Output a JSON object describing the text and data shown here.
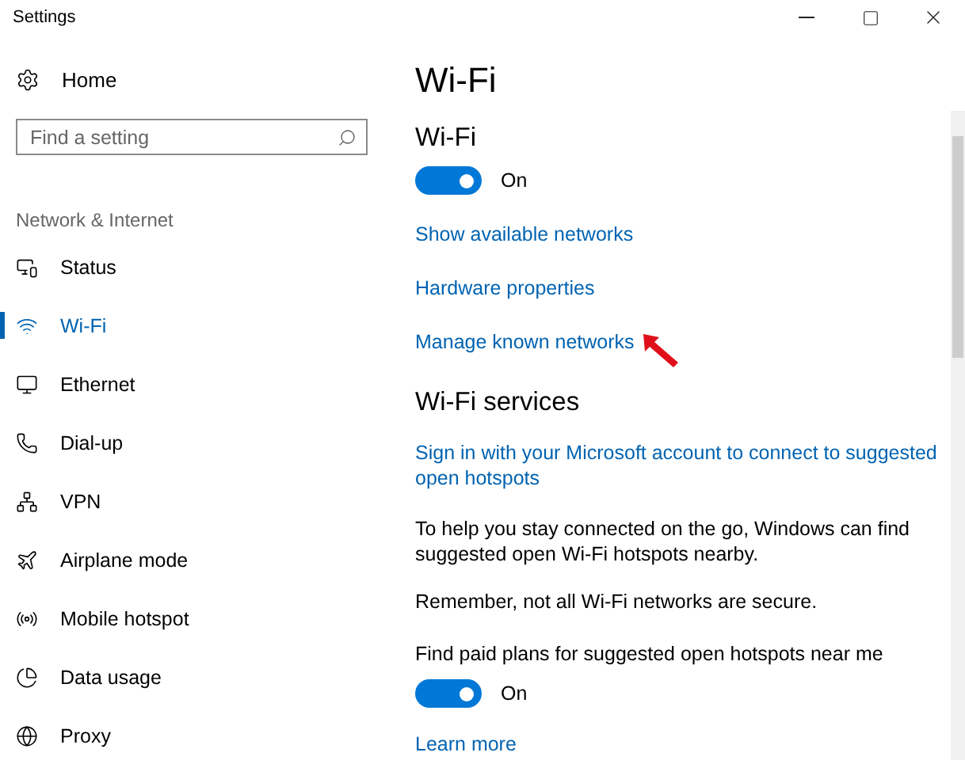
{
  "window": {
    "title": "Settings"
  },
  "sidebar": {
    "home": "Home",
    "search": {
      "placeholder": "Find a setting"
    },
    "section": "Network & Internet",
    "items": [
      {
        "label": "Status",
        "selected": false
      },
      {
        "label": "Wi-Fi",
        "selected": true
      },
      {
        "label": "Ethernet",
        "selected": false
      },
      {
        "label": "Dial-up",
        "selected": false
      },
      {
        "label": "VPN",
        "selected": false
      },
      {
        "label": "Airplane mode",
        "selected": false
      },
      {
        "label": "Mobile hotspot",
        "selected": false
      },
      {
        "label": "Data usage",
        "selected": false
      },
      {
        "label": "Proxy",
        "selected": false
      }
    ]
  },
  "page": {
    "title": "Wi-Fi"
  },
  "wifi": {
    "heading": "Wi-Fi",
    "toggle": {
      "on": true,
      "label": "On"
    },
    "links": [
      "Show available networks",
      "Hardware properties",
      "Manage known networks"
    ]
  },
  "services": {
    "heading": "Wi-Fi services",
    "sign_in_link": "Sign in with your Microsoft account to connect to suggested open hotspots",
    "description": "To help you stay connected on the go, Windows can find suggested open Wi-Fi hotspots nearby.",
    "warning": "Remember, not all Wi-Fi networks are secure.",
    "paid_plans": {
      "label": "Find paid plans for suggested open hotspots near me",
      "toggle": {
        "on": true,
        "label": "On"
      }
    },
    "learn_more": "Learn more"
  }
}
